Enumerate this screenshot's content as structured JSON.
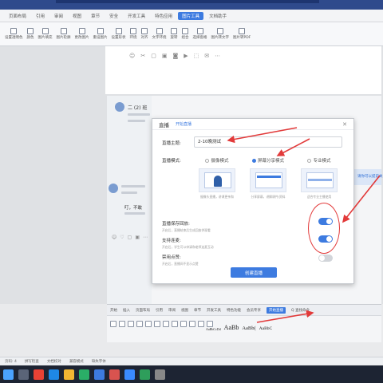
{
  "menubar": {
    "tabs": [
      {
        "label": "页面布局"
      },
      {
        "label": "引用"
      },
      {
        "label": "审阅"
      },
      {
        "label": "视图"
      },
      {
        "label": "章节"
      },
      {
        "label": "安全"
      },
      {
        "label": "开发工具"
      },
      {
        "label": "特色应用"
      },
      {
        "label": "图片工具",
        "active": true
      },
      {
        "label": "文档助手"
      }
    ]
  },
  "ribbon": {
    "items": [
      {
        "label": "设置透明色"
      },
      {
        "label": "颜色"
      },
      {
        "label": "图片填充"
      },
      {
        "label": "图片轮廓"
      },
      {
        "label": "更改图片"
      },
      {
        "label": "重设图片"
      },
      {
        "label": "设置形状"
      },
      {
        "label": "环绕"
      },
      {
        "label": "对齐"
      },
      {
        "label": "文字环绕"
      },
      {
        "label": "旋转"
      },
      {
        "label": "组合"
      },
      {
        "label": "选择窗格"
      },
      {
        "label": "图片转文字"
      },
      {
        "label": "图片转PDF"
      }
    ]
  },
  "chat": {
    "sender": "二 (2) 班",
    "message": "叮，不敢"
  },
  "right_block": {
    "text": "请你可以提前关"
  },
  "dialog": {
    "title": "直播",
    "subtitle": "开始直播",
    "topic_label": "直播主题:",
    "topic_value": "2-10晚测试",
    "mode_label": "直播模式:",
    "modes": [
      {
        "label": "摄像模式",
        "desc": "摄像头直播，讲课更亲和",
        "selected": false
      },
      {
        "label": "屏幕分享模式",
        "desc": "分享屏幕，讲解课件/资料",
        "selected": true
      },
      {
        "label": "专业模式",
        "desc": "适合专业主播使用",
        "selected": false
      }
    ],
    "options": [
      {
        "label": "直播保存回放:",
        "desc": "开启后，直播结束后生成回放供观看",
        "enabled": true
      },
      {
        "label": "支持连麦:",
        "desc": "开启后，学生可以申请和老师连麦互动",
        "enabled": true
      },
      {
        "label": "禁用点赞:",
        "desc": "开启后，直播间不显示点赞",
        "enabled": false
      }
    ],
    "create_button": "创建直播"
  },
  "ribbon2": {
    "tabs": [
      {
        "label": "开始"
      },
      {
        "label": "插入"
      },
      {
        "label": "页面布局"
      },
      {
        "label": "引用"
      },
      {
        "label": "审阅"
      },
      {
        "label": "视图"
      },
      {
        "label": "章节"
      },
      {
        "label": "开发工具"
      },
      {
        "label": "特色功能"
      },
      {
        "label": "会员专享"
      },
      {
        "label": "开始直播",
        "active": true
      },
      {
        "label": "Q 查找命令"
      }
    ],
    "styles": [
      {
        "label": "AaBbCcDd",
        "size": 4
      },
      {
        "label": "AaBb",
        "size": 8
      },
      {
        "label": "AaBb(",
        "size": 6.5
      },
      {
        "label": "AaBbC",
        "size": 5.5
      }
    ]
  },
  "statusbar": {
    "items": [
      {
        "label": "页码: 4"
      },
      {
        "label": "拼写检查"
      },
      {
        "label": "文档校对"
      },
      {
        "label": "兼容模式"
      },
      {
        "label": "缺失字体"
      }
    ]
  },
  "taskbar": {
    "apps": [
      {
        "name": "windows-icon",
        "color": "#4aa3ff"
      },
      {
        "name": "search-icon",
        "color": "#5a6478"
      },
      {
        "name": "chrome-icon",
        "color": "#e94235"
      },
      {
        "name": "ie-icon",
        "color": "#1e88e5"
      },
      {
        "name": "folder-icon",
        "color": "#f2b632"
      },
      {
        "name": "wechat-icon",
        "color": "#2aae67"
      },
      {
        "name": "video-icon",
        "color": "#3d7be0"
      },
      {
        "name": "wps-icon",
        "color": "#d9534f"
      },
      {
        "name": "dingtalk-icon",
        "color": "#3a8bff"
      },
      {
        "name": "sheet-icon",
        "color": "#2e9e5b"
      },
      {
        "name": "app-icon",
        "color": "#888888"
      }
    ]
  },
  "colors": {
    "accent": "#3d7be0",
    "annotation": "#e23a3a"
  }
}
